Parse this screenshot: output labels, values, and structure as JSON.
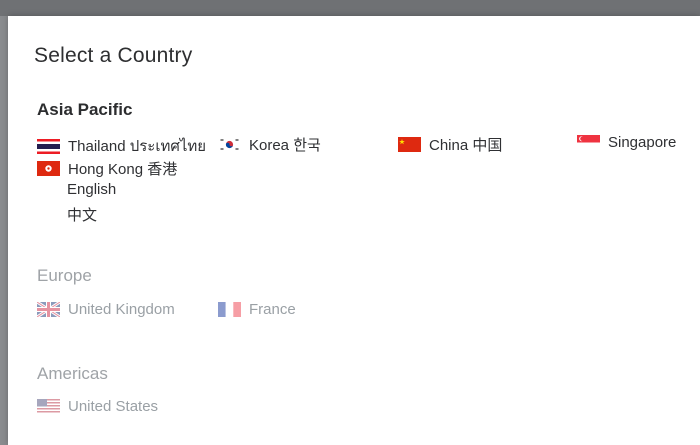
{
  "dialog": {
    "title": "Select a Country"
  },
  "regions": {
    "asia_pacific": {
      "title": "Asia Pacific",
      "countries": {
        "thailand": "Thailand ประเทศไทย",
        "korea": "Korea 한국",
        "china": "China 中国",
        "singapore": "Singapore",
        "hong_kong": "Hong Kong 香港"
      },
      "hong_kong_languages": [
        "English",
        "中文"
      ]
    },
    "europe": {
      "title": "Europe",
      "countries": {
        "uk": "United Kingdom",
        "france": "France"
      }
    },
    "americas": {
      "title": "Americas",
      "countries": {
        "us": "United States"
      }
    }
  },
  "colors": {
    "overlay": "#7d7f82",
    "modal_bg": "#ffffff",
    "text": "#2f3033",
    "muted_text": "#9aa0a5",
    "flag_red": "#d7261e"
  }
}
